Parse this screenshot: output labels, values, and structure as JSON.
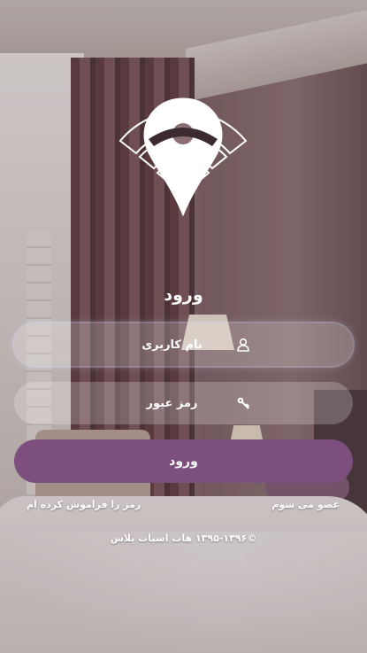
{
  "login": {
    "title": "ورود",
    "username_placeholder": "نام کاربری",
    "password_placeholder": "رمز عبور",
    "submit_label": "ورود"
  },
  "links": {
    "forgot_password": "رمز را فراموش کرده ام",
    "register": "عضو می شوم"
  },
  "footer": {
    "copyright": "©۱۳۹۵-۱۳۹۶ هات اسپات پلاس"
  },
  "icons": {
    "logo": "location-pin-wifi-icon",
    "username": "user-icon",
    "password": "key-icon"
  },
  "colors": {
    "accent": "#7c4f7f",
    "text": "#ffffff"
  }
}
